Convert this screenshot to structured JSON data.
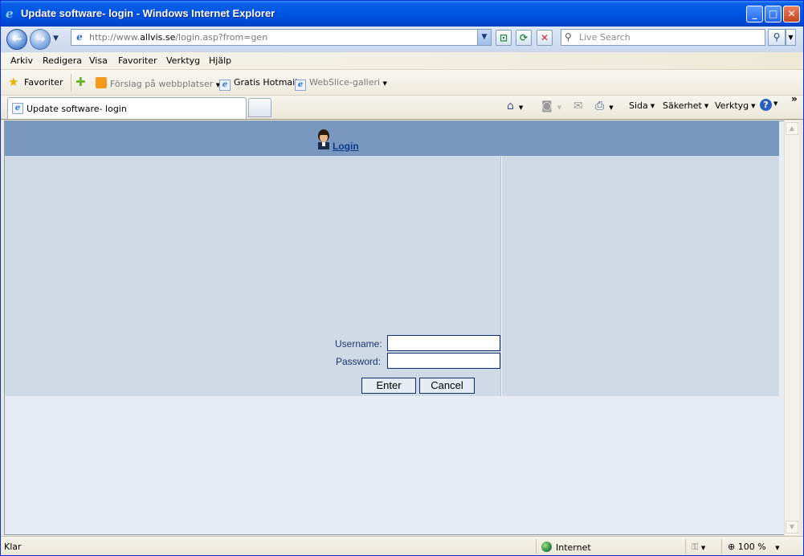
{
  "window": {
    "title": "Update software- login - Windows Internet Explorer",
    "controls": {
      "minimize": "_",
      "maximize": "□",
      "close": "✕"
    }
  },
  "address_bar": {
    "url_prefix": "http://www.",
    "url_domain": "allvis.se",
    "url_path": "/login.asp?from=gen",
    "search_placeholder": "Live Search"
  },
  "menu": [
    "Arkiv",
    "Redigera",
    "Visa",
    "Favoriter",
    "Verktyg",
    "Hjälp"
  ],
  "favorites_bar": {
    "favorites_label": "Favoriter",
    "items": [
      "Förslag på webbplatser",
      "Gratis Hotmail",
      "WebSlice-galleri"
    ]
  },
  "tabs": [
    {
      "label": "Update software- login"
    }
  ],
  "command_bar": {
    "page": "Sida",
    "safety": "Säkerhet",
    "tools": "Verktyg"
  },
  "page": {
    "login_link": "Login",
    "username_label": "Username:",
    "password_label": "Password:",
    "username_value": "",
    "password_value": "",
    "enter_button": "Enter",
    "cancel_button": "Cancel"
  },
  "status_bar": {
    "status": "Klar",
    "zone": "Internet",
    "zoom": "100 %"
  },
  "colors": {
    "header_band": "#7a98bf",
    "form_panel": "#cfdae6",
    "page_background": "#e8ecf5",
    "link": "#0a3a8a"
  }
}
